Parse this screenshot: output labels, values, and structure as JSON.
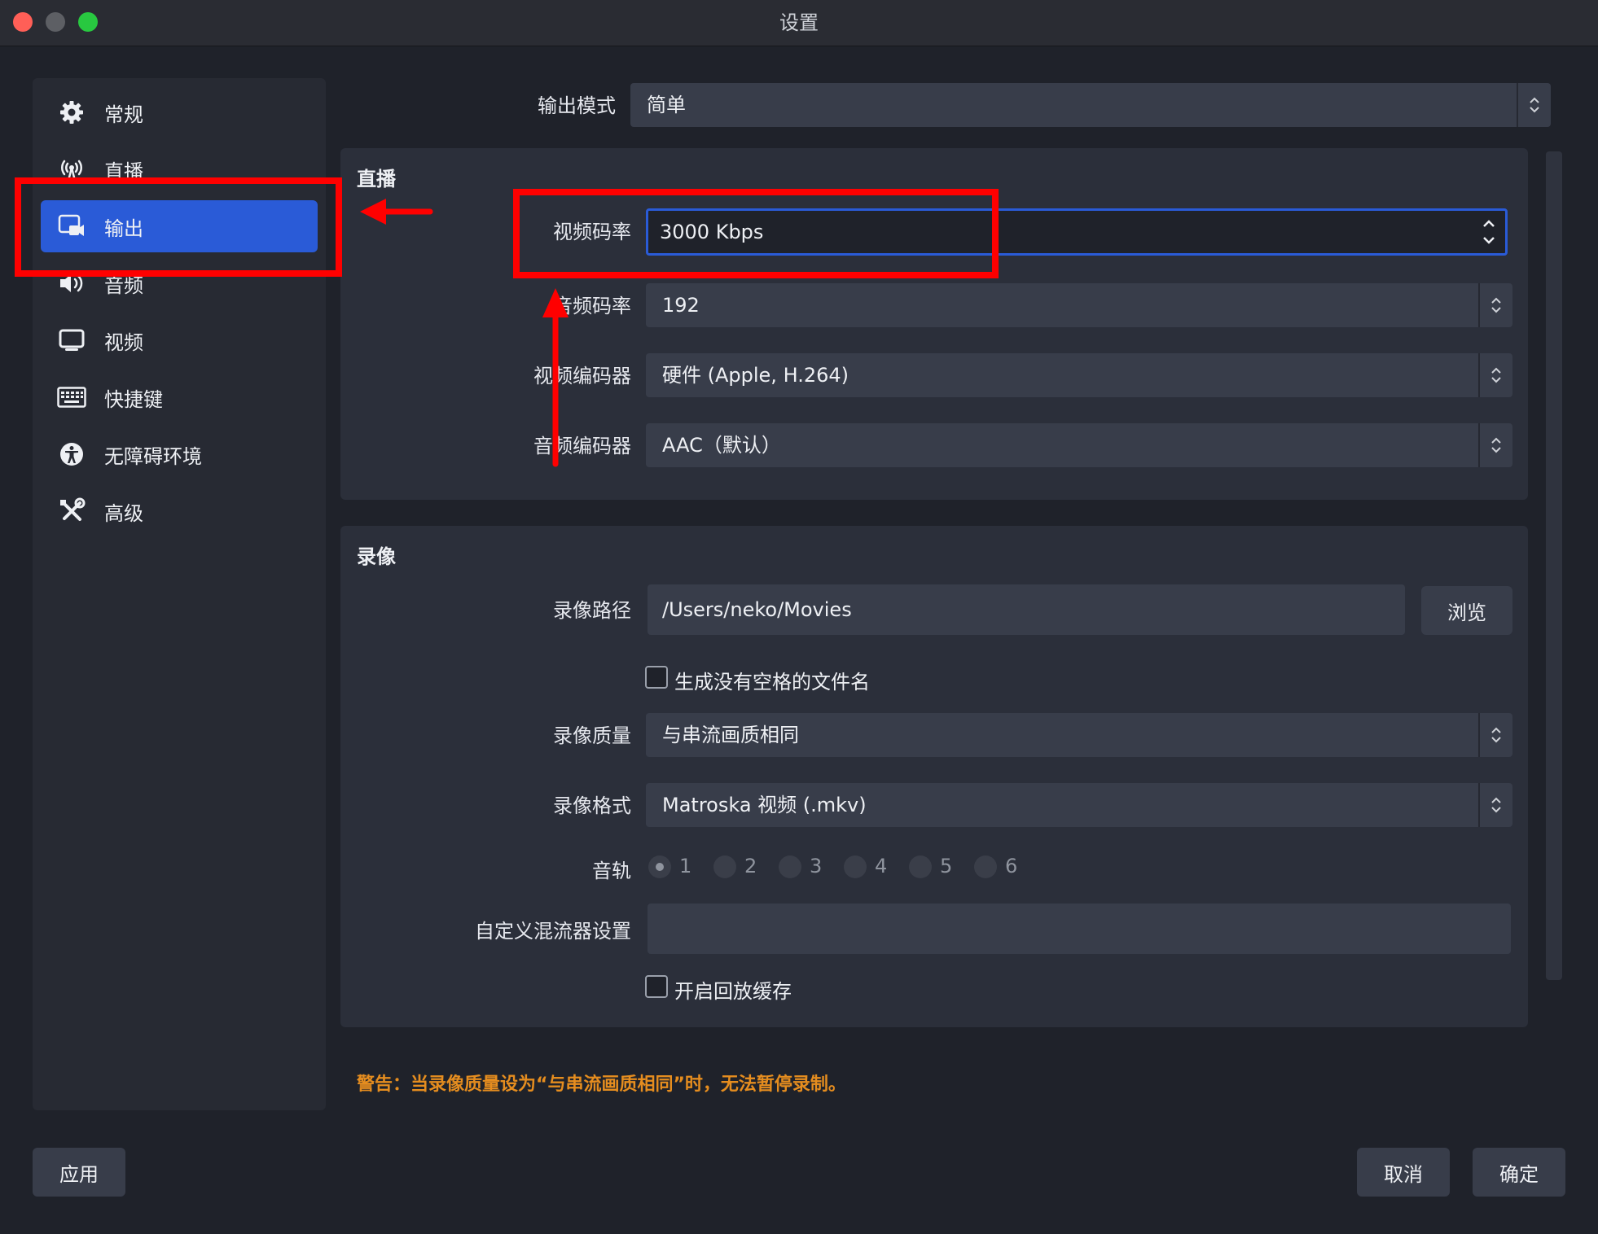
{
  "window": {
    "title": "设置"
  },
  "sidebar": {
    "items": [
      {
        "label": "常规",
        "icon": "gear-icon"
      },
      {
        "label": "直播",
        "icon": "antenna-icon"
      },
      {
        "label": "输出",
        "icon": "output-icon",
        "active": true
      },
      {
        "label": "音频",
        "icon": "speaker-icon"
      },
      {
        "label": "视频",
        "icon": "monitor-icon"
      },
      {
        "label": "快捷键",
        "icon": "keyboard-icon"
      },
      {
        "label": "无障碍环境",
        "icon": "accessibility-icon"
      },
      {
        "label": "高级",
        "icon": "tools-icon"
      }
    ]
  },
  "output_mode": {
    "label": "输出模式",
    "value": "简单"
  },
  "streaming": {
    "title": "直播",
    "video_bitrate": {
      "label": "视频码率",
      "value": "3000 Kbps"
    },
    "audio_bitrate": {
      "label": "音频码率",
      "value": "192"
    },
    "video_encoder": {
      "label": "视频编码器",
      "value": "硬件 (Apple, H.264)"
    },
    "audio_encoder": {
      "label": "音频编码器",
      "value": "AAC（默认）"
    }
  },
  "recording": {
    "title": "录像",
    "path": {
      "label": "录像路径",
      "value": "/Users/neko/Movies",
      "browse": "浏览"
    },
    "no_space_filename": {
      "label": "生成没有空格的文件名",
      "checked": false
    },
    "quality": {
      "label": "录像质量",
      "value": "与串流画质相同"
    },
    "format": {
      "label": "录像格式",
      "value": "Matroska 视频 (.mkv)"
    },
    "tracks": {
      "label": "音轨",
      "options": [
        "1",
        "2",
        "3",
        "4",
        "5",
        "6"
      ],
      "selected": "1"
    },
    "muxer": {
      "label": "自定义混流器设置",
      "value": ""
    },
    "replay_buffer": {
      "label": "开启回放缓存",
      "checked": false
    }
  },
  "warning": "警告：当录像质量设为“与串流画质相同”时，无法暂停录制。",
  "footer": {
    "apply": "应用",
    "cancel": "取消",
    "ok": "确定"
  },
  "colors": {
    "accent": "#2a5bd7",
    "warning": "#e58d1f",
    "annotation": "#ff0000"
  }
}
